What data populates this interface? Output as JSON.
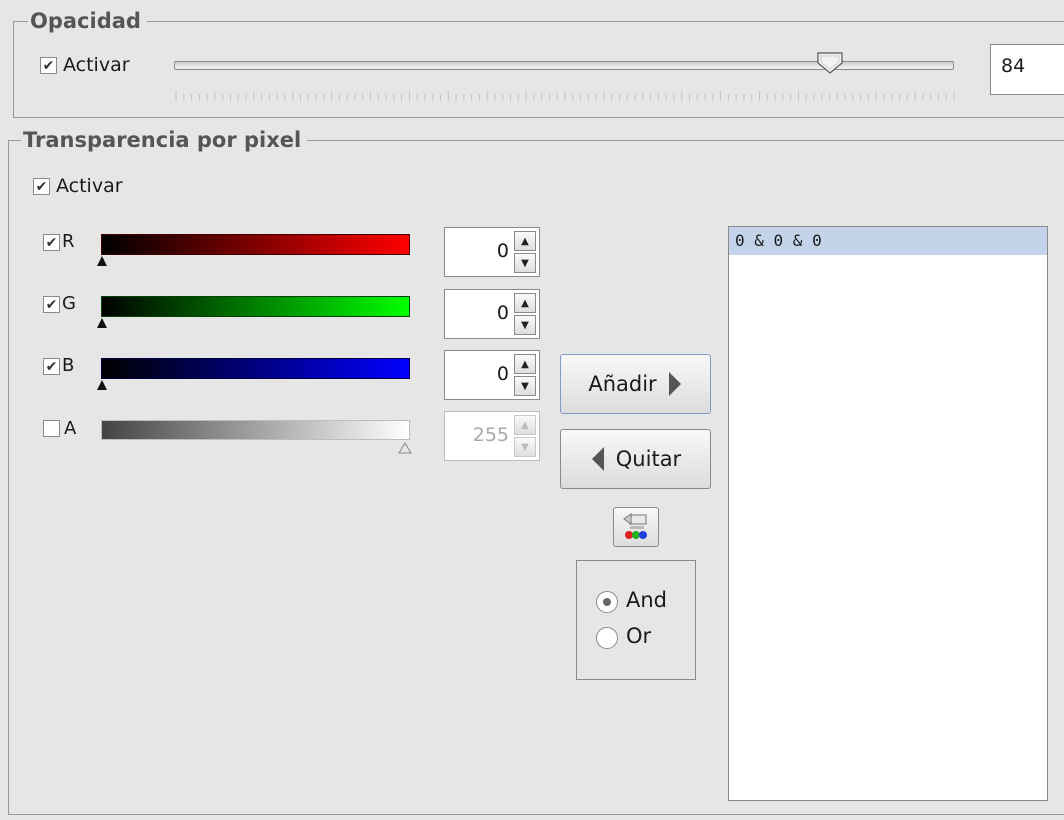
{
  "opacity": {
    "title": "Opacidad",
    "activate_label": "Activar",
    "activated": true,
    "value": "84",
    "slider_fraction": 0.84
  },
  "pixel_transparency": {
    "title": "Transparencia por pixel",
    "activate_label": "Activar",
    "activated": true,
    "channels": [
      {
        "label": "R",
        "checked": true,
        "value": "0",
        "enabled": true,
        "color": "#ff0000"
      },
      {
        "label": "G",
        "checked": true,
        "value": "0",
        "enabled": true,
        "color": "#00ff00"
      },
      {
        "label": "B",
        "checked": true,
        "value": "0",
        "enabled": true,
        "color": "#0000ff"
      },
      {
        "label": "A",
        "checked": false,
        "value": "255",
        "enabled": false,
        "color": "#ffffff"
      }
    ],
    "add_button_label": "Añadir",
    "remove_button_label": "Quitar",
    "pick_color_icon": "color-picker-icon",
    "logic": {
      "options": [
        "And",
        "Or"
      ],
      "selected": "And"
    },
    "list_items": [
      "0 & 0 & 0"
    ]
  }
}
